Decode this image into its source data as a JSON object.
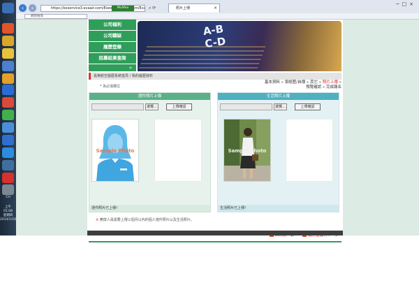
{
  "browser": {
    "url": "https://exservice3.evaair.com/Exes/Chinese/Exam/Exam02A.aspx",
    "tab_title": "照片上傳",
    "search_placeholder": "網頁搜尋",
    "mcafee_label": "McAfee",
    "tab_close": "×",
    "window_buttons": "─□×"
  },
  "taskbar": {
    "lang": "CH",
    "time": "上午 01:08",
    "weekday": "星期四",
    "date": "2014/1/16"
  },
  "menu": {
    "items": [
      "公司福利",
      "公司職缺",
      "履歷登錄",
      "招募結果查詢"
    ],
    "more": "»"
  },
  "banner": {
    "text_line1": "A-B",
    "text_line2": "C-D"
  },
  "breadcrumb": "長榮航空履歷系統首頁 / 我的履歷資料",
  "steps": {
    "items": [
      "基本資料",
      "學經歷/自傳",
      "其它",
      "照片上傳",
      "預覽確認",
      "完成報名"
    ],
    "separator": " » ",
    "active_index": 3
  },
  "required_note": {
    "star": "*",
    "text": "為必填欄位"
  },
  "panels": {
    "id_photo": {
      "title": "證件照片上傳",
      "browse": "瀏覽...",
      "upload": "上傳確認",
      "sample": "Sample Photo",
      "status": "證件照片已上傳！"
    },
    "life_photo": {
      "title": "生活照片上傳",
      "browse": "瀏覽...",
      "upload": "上傳確認",
      "sample": "Sample Photo",
      "status": "生活照片已上傳！"
    }
  },
  "notice": {
    "dot": "※",
    "text": "應徵人員需要上傳三個月以內的個人證件照片以及生活照片。"
  },
  "actions": {
    "back": "回到前一頁",
    "next": "儲存並進行下一步"
  },
  "colors": {
    "menu_green": "#2f9e5a",
    "left_head": "#5bb089",
    "right_head": "#4fb0bf",
    "active_step": "#d62d2d"
  }
}
